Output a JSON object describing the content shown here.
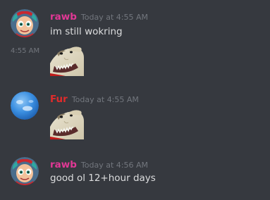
{
  "colors": {
    "background": "#36393f",
    "rawb_name": "#e13895",
    "fur_name": "#e02b2b",
    "text": "#dcddde",
    "timestamp": "#72767d"
  },
  "messages": [
    {
      "username": "rawb",
      "timestamp": "Today at 4:55 AM",
      "avatar": "cartoon-character-avatar",
      "text": "im still wokring",
      "followup": {
        "side_time": "4:55 AM",
        "attachment": "opossum-emote"
      }
    },
    {
      "username": "Fur",
      "timestamp": "Today at 4:55 AM",
      "avatar": "blue-sky-avatar",
      "attachment": "opossum-emote"
    },
    {
      "username": "rawb",
      "timestamp": "Today at 4:56 AM",
      "avatar": "cartoon-character-avatar",
      "text": "good ol 12+hour days"
    }
  ]
}
